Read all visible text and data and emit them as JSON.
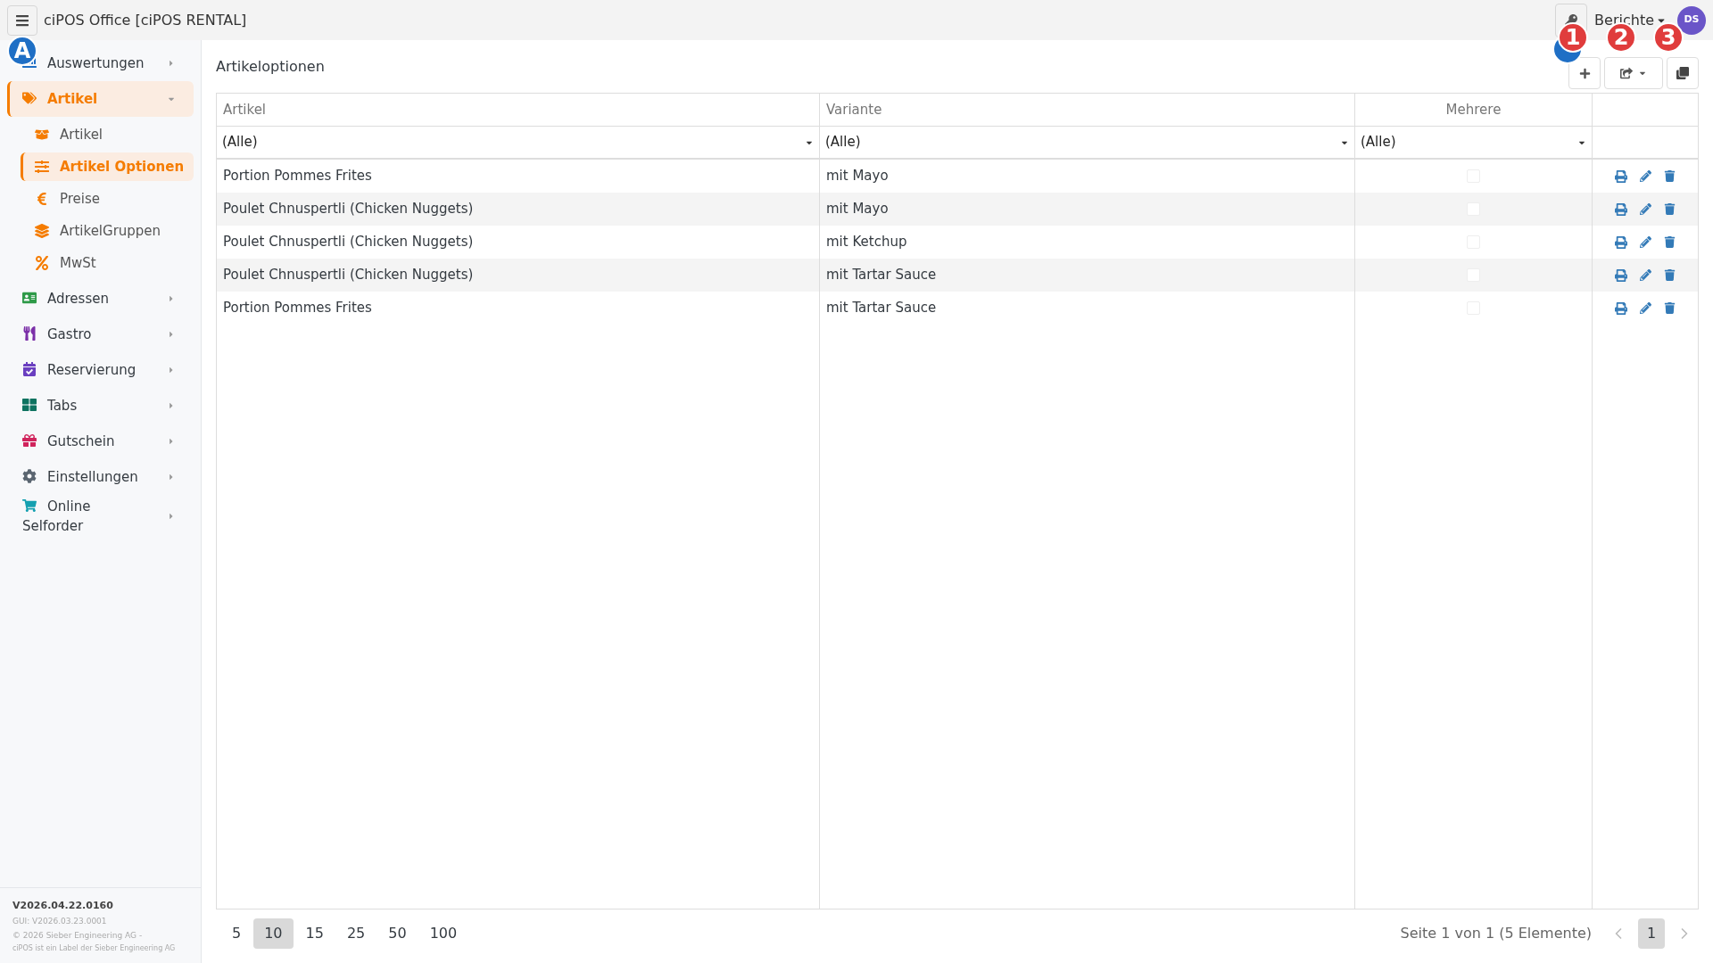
{
  "topbar": {
    "title": "ciPOS Office [ciPOS RENTAL]",
    "reports_menu": "Berichte",
    "avatar": "DS"
  },
  "sidebar": {
    "items": [
      {
        "label": "Auswertungen",
        "selected": false,
        "expanded": false
      },
      {
        "label": "Artikel",
        "selected": true,
        "expanded": true,
        "children": [
          {
            "label": "Artikel",
            "selected": false
          },
          {
            "label": "Artikel Optionen",
            "selected": true
          },
          {
            "label": "Preise",
            "selected": false
          },
          {
            "label": "ArtikelGruppen",
            "selected": false
          },
          {
            "label": "MwSt",
            "selected": false
          }
        ]
      },
      {
        "label": "Adressen",
        "selected": false,
        "expanded": false
      },
      {
        "label": "Gastro",
        "selected": false,
        "expanded": false
      },
      {
        "label": "Reservierung",
        "selected": false,
        "expanded": false
      },
      {
        "label": "Tabs",
        "selected": false,
        "expanded": false
      },
      {
        "label": "Gutschein",
        "selected": false,
        "expanded": false
      },
      {
        "label": "Einstellungen",
        "selected": false,
        "expanded": false
      },
      {
        "label": "Online Selforder",
        "selected": false,
        "expanded": false
      }
    ],
    "footer": {
      "version": "V2026.04.22.0160",
      "gui_version": "GUI: V2026.03.23.0001",
      "copyright": "© 2026 Sieber Engineering AG -",
      "label_note": "ciPOS ist ein Label der Sieber Engineering AG"
    }
  },
  "page": {
    "title": "Artikeloptionen"
  },
  "table": {
    "columns": [
      "Artikel",
      "Variante",
      "Mehrere"
    ],
    "filters": [
      "(Alle)",
      "(Alle)",
      "(Alle)"
    ],
    "rows": [
      {
        "artikel": "Portion Pommes Frites",
        "variante": "mit Mayo",
        "mehrere": false
      },
      {
        "artikel": "Poulet Chnuspertli (Chicken Nuggets)",
        "variante": "mit Mayo",
        "mehrere": false
      },
      {
        "artikel": "Poulet Chnuspertli (Chicken Nuggets)",
        "variante": "mit Ketchup",
        "mehrere": false
      },
      {
        "artikel": "Poulet Chnuspertli (Chicken Nuggets)",
        "variante": "mit Tartar Sauce",
        "mehrere": false
      },
      {
        "artikel": "Portion Pommes Frites",
        "variante": "mit Tartar Sauce",
        "mehrere": false
      }
    ]
  },
  "pagination": {
    "page_sizes": [
      {
        "label": "5",
        "selected": false
      },
      {
        "label": "10",
        "selected": true
      },
      {
        "label": "15",
        "selected": false
      },
      {
        "label": "25",
        "selected": false
      },
      {
        "label": "50",
        "selected": false
      },
      {
        "label": "100",
        "selected": false
      }
    ],
    "info": "Seite 1 von 1 (5 Elemente)",
    "pages": [
      {
        "label": "1",
        "selected": true
      }
    ]
  },
  "annotations": [
    {
      "text": "A",
      "color": "#1f6fc5"
    },
    {
      "text": "1",
      "color": "#e03c3c"
    },
    {
      "text": "2",
      "color": "#e03c3c"
    },
    {
      "text": "3",
      "color": "#e03c3c"
    }
  ]
}
